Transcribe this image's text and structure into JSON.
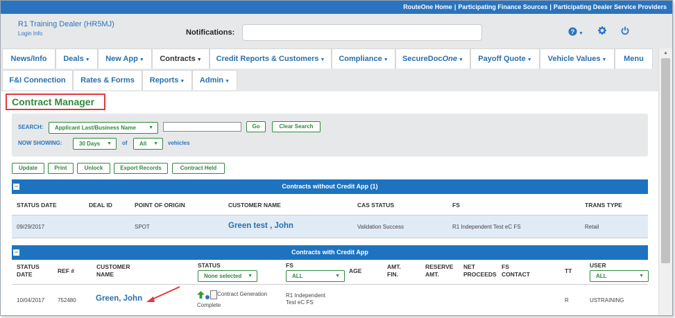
{
  "topbar": {
    "links": [
      "RouteOne Home",
      "Participating Finance Sources",
      "Participating Dealer Service Providers"
    ]
  },
  "header": {
    "dealer": "R1 Training Dealer (HR5MJ)",
    "login": "Login Info",
    "notifications_label": "Notifications:",
    "notifications_value": "",
    "help_icon": "question-circle-icon",
    "settings_icon": "gear-icon",
    "power_icon": "power-icon"
  },
  "nav": {
    "row1": [
      "News/Info",
      "Deals",
      "New App",
      "Contracts",
      "Credit Reports & Customers",
      "Compliance",
      "SecureDoc",
      "Payoff Quote",
      "Vehicle Values",
      "Menu"
    ],
    "securedoc_suffix": "One",
    "row2": [
      "F&I Connection",
      "Rates & Forms",
      "Reports",
      "Admin"
    ],
    "active": "Contracts"
  },
  "page": {
    "title": "Contract Manager"
  },
  "search": {
    "search_label": "SEARCH:",
    "field_select": "Applicant Last/Business Name",
    "text_value": "",
    "go": "Go",
    "clear": "Clear Search",
    "showing_label": "NOW SHOWING:",
    "days_select": "30 Days",
    "of": "of",
    "all_select": "All",
    "vehicles": "vehicles"
  },
  "actions": [
    "Update",
    "Print",
    "Unlock",
    "Export Records",
    "Contract Held"
  ],
  "section1": {
    "title": "Contracts without Credit App (1)",
    "headers": [
      "STATUS DATE",
      "DEAL ID",
      "POINT OF ORIGIN",
      "CUSTOMER NAME",
      "CAS STATUS",
      "FS",
      "TRANS TYPE"
    ],
    "row": {
      "status_date": "09/29/2017",
      "deal_id": "",
      "origin": "SPOT",
      "customer": "Green test , John",
      "cas_status": "Validation Success",
      "fs": "R1 Independent Test eC FS",
      "trans_type": "Retail"
    }
  },
  "section2": {
    "title": "Contracts with Credit App",
    "headers": {
      "status_date": [
        "STATUS",
        "DATE"
      ],
      "ref": "REF #",
      "customer": [
        "CUSTOMER",
        "NAME"
      ],
      "status": "STATUS",
      "fs": "FS",
      "age": "AGE",
      "amt_fin": [
        "AMT.",
        "FIN."
      ],
      "reserve": [
        "RESERVE",
        "AMT."
      ],
      "net": [
        "NET",
        "PROCEEDS"
      ],
      "fs_contact": [
        "FS",
        "CONTACT"
      ],
      "tt": "TT",
      "user": "USER"
    },
    "status_filter": "None selected",
    "fs_filter": "ALL",
    "user_filter": "ALL",
    "row": {
      "status_date": "10/04/2017",
      "ref": "752480",
      "customer": "Green, John",
      "status_line1": "Contract Generation",
      "status_line2": "Complete",
      "fs_line1": "R1 Independent",
      "fs_line2": "Test eC FS",
      "tt": "R",
      "user": "USTRAINING"
    }
  }
}
